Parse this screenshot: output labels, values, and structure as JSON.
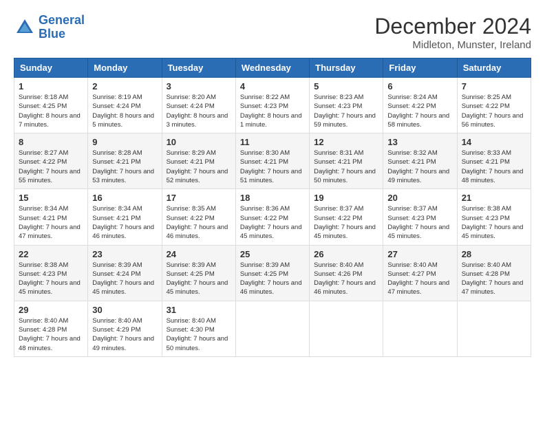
{
  "header": {
    "logo_line1": "General",
    "logo_line2": "Blue",
    "month_title": "December 2024",
    "location": "Midleton, Munster, Ireland"
  },
  "weekdays": [
    "Sunday",
    "Monday",
    "Tuesday",
    "Wednesday",
    "Thursday",
    "Friday",
    "Saturday"
  ],
  "weeks": [
    [
      {
        "day": "1",
        "sunrise": "8:18 AM",
        "sunset": "4:25 PM",
        "daylight": "8 hours and 7 minutes."
      },
      {
        "day": "2",
        "sunrise": "8:19 AM",
        "sunset": "4:24 PM",
        "daylight": "8 hours and 5 minutes."
      },
      {
        "day": "3",
        "sunrise": "8:20 AM",
        "sunset": "4:24 PM",
        "daylight": "8 hours and 3 minutes."
      },
      {
        "day": "4",
        "sunrise": "8:22 AM",
        "sunset": "4:23 PM",
        "daylight": "8 hours and 1 minute."
      },
      {
        "day": "5",
        "sunrise": "8:23 AM",
        "sunset": "4:23 PM",
        "daylight": "7 hours and 59 minutes."
      },
      {
        "day": "6",
        "sunrise": "8:24 AM",
        "sunset": "4:22 PM",
        "daylight": "7 hours and 58 minutes."
      },
      {
        "day": "7",
        "sunrise": "8:25 AM",
        "sunset": "4:22 PM",
        "daylight": "7 hours and 56 minutes."
      }
    ],
    [
      {
        "day": "8",
        "sunrise": "8:27 AM",
        "sunset": "4:22 PM",
        "daylight": "7 hours and 55 minutes."
      },
      {
        "day": "9",
        "sunrise": "8:28 AM",
        "sunset": "4:21 PM",
        "daylight": "7 hours and 53 minutes."
      },
      {
        "day": "10",
        "sunrise": "8:29 AM",
        "sunset": "4:21 PM",
        "daylight": "7 hours and 52 minutes."
      },
      {
        "day": "11",
        "sunrise": "8:30 AM",
        "sunset": "4:21 PM",
        "daylight": "7 hours and 51 minutes."
      },
      {
        "day": "12",
        "sunrise": "8:31 AM",
        "sunset": "4:21 PM",
        "daylight": "7 hours and 50 minutes."
      },
      {
        "day": "13",
        "sunrise": "8:32 AM",
        "sunset": "4:21 PM",
        "daylight": "7 hours and 49 minutes."
      },
      {
        "day": "14",
        "sunrise": "8:33 AM",
        "sunset": "4:21 PM",
        "daylight": "7 hours and 48 minutes."
      }
    ],
    [
      {
        "day": "15",
        "sunrise": "8:34 AM",
        "sunset": "4:21 PM",
        "daylight": "7 hours and 47 minutes."
      },
      {
        "day": "16",
        "sunrise": "8:34 AM",
        "sunset": "4:21 PM",
        "daylight": "7 hours and 46 minutes."
      },
      {
        "day": "17",
        "sunrise": "8:35 AM",
        "sunset": "4:22 PM",
        "daylight": "7 hours and 46 minutes."
      },
      {
        "day": "18",
        "sunrise": "8:36 AM",
        "sunset": "4:22 PM",
        "daylight": "7 hours and 45 minutes."
      },
      {
        "day": "19",
        "sunrise": "8:37 AM",
        "sunset": "4:22 PM",
        "daylight": "7 hours and 45 minutes."
      },
      {
        "day": "20",
        "sunrise": "8:37 AM",
        "sunset": "4:23 PM",
        "daylight": "7 hours and 45 minutes."
      },
      {
        "day": "21",
        "sunrise": "8:38 AM",
        "sunset": "4:23 PM",
        "daylight": "7 hours and 45 minutes."
      }
    ],
    [
      {
        "day": "22",
        "sunrise": "8:38 AM",
        "sunset": "4:23 PM",
        "daylight": "7 hours and 45 minutes."
      },
      {
        "day": "23",
        "sunrise": "8:39 AM",
        "sunset": "4:24 PM",
        "daylight": "7 hours and 45 minutes."
      },
      {
        "day": "24",
        "sunrise": "8:39 AM",
        "sunset": "4:25 PM",
        "daylight": "7 hours and 45 minutes."
      },
      {
        "day": "25",
        "sunrise": "8:39 AM",
        "sunset": "4:25 PM",
        "daylight": "7 hours and 46 minutes."
      },
      {
        "day": "26",
        "sunrise": "8:40 AM",
        "sunset": "4:26 PM",
        "daylight": "7 hours and 46 minutes."
      },
      {
        "day": "27",
        "sunrise": "8:40 AM",
        "sunset": "4:27 PM",
        "daylight": "7 hours and 47 minutes."
      },
      {
        "day": "28",
        "sunrise": "8:40 AM",
        "sunset": "4:28 PM",
        "daylight": "7 hours and 47 minutes."
      }
    ],
    [
      {
        "day": "29",
        "sunrise": "8:40 AM",
        "sunset": "4:28 PM",
        "daylight": "7 hours and 48 minutes."
      },
      {
        "day": "30",
        "sunrise": "8:40 AM",
        "sunset": "4:29 PM",
        "daylight": "7 hours and 49 minutes."
      },
      {
        "day": "31",
        "sunrise": "8:40 AM",
        "sunset": "4:30 PM",
        "daylight": "7 hours and 50 minutes."
      },
      null,
      null,
      null,
      null
    ]
  ]
}
